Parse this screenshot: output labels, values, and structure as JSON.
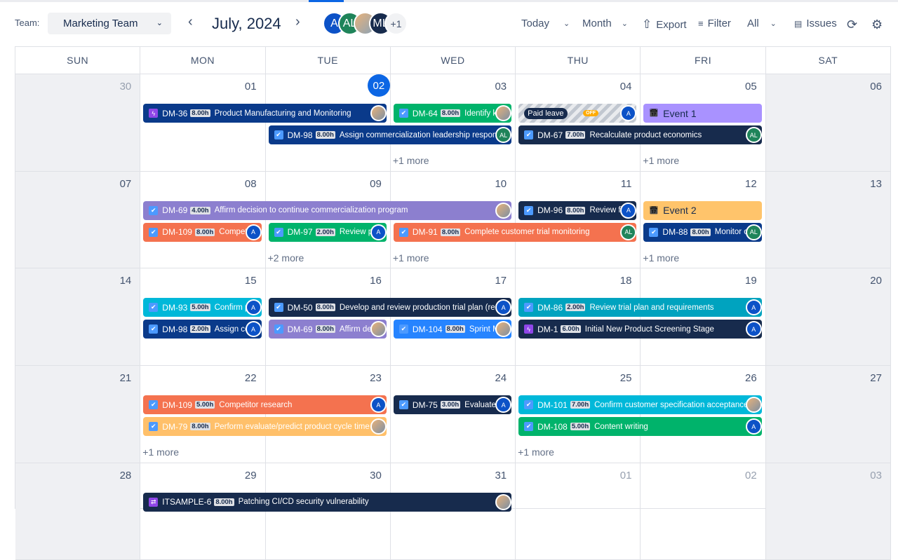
{
  "header": {
    "team_label": "Team:",
    "team_value": "Marketing Team",
    "month_title": "July, 2024",
    "avatars": [
      {
        "initials": "A",
        "color": "#0c52c7"
      },
      {
        "initials": "AL",
        "color": "#1f845a"
      },
      {
        "initials": "",
        "color": "#c9a27e"
      },
      {
        "initials": "ML",
        "color": "#172b4d"
      }
    ],
    "more_avatars": "+1",
    "today_label": "Today",
    "view_label": "Month",
    "export_label": "Export",
    "filter_label": "Filter",
    "filter_value": "All",
    "issues_label": "Issues"
  },
  "calendar": {
    "day_headers": [
      "SUN",
      "MON",
      "TUE",
      "WED",
      "THU",
      "FRI",
      "SAT"
    ],
    "today_date": "02",
    "weeks": [
      {
        "dates": [
          "30",
          "01",
          "02",
          "03",
          "04",
          "05",
          "06"
        ],
        "outside": [
          0
        ],
        "lanes": [
          [
            {
              "start": 1,
              "days": 2,
              "key": "DM-36",
              "hours": "8.00h",
              "title": "Product Manufacturing and Monitoring",
              "color": "#0a3a8a",
              "icon": "bolt",
              "assignee": "photo"
            },
            {
              "start": 3,
              "days": 1,
              "key": "DM-64",
              "hours": "8.00h",
              "title": "Identify key",
              "color": "#00b36b",
              "icon": "check",
              "assignee": "photo"
            },
            {
              "start": 4,
              "days": 1,
              "type": "leave",
              "title": "Paid leave",
              "badge": "OFF",
              "assignee": "A"
            },
            {
              "start": 5,
              "days": 1,
              "type": "event",
              "title": "Event 1",
              "color": "#a992ff"
            }
          ],
          [
            {
              "start": 2,
              "days": 2,
              "key": "DM-98",
              "hours": "8.00h",
              "title": "Assign commercialization leadership respon",
              "color": "#0a3a8a",
              "icon": "check",
              "assignee": "AL"
            },
            {
              "start": 4,
              "days": 2,
              "key": "DM-67",
              "hours": "7.00h",
              "title": "Recalculate product economics",
              "color": "#172b4d",
              "icon": "check",
              "assignee": "AL"
            }
          ]
        ],
        "more": [
          {
            "day": 3,
            "label": "+1 more"
          },
          {
            "day": 5,
            "label": "+1 more"
          }
        ]
      },
      {
        "dates": [
          "07",
          "08",
          "09",
          "10",
          "11",
          "12",
          "13"
        ],
        "outside": [],
        "lanes": [
          [
            {
              "start": 1,
              "days": 3,
              "key": "DM-69",
              "hours": "4.00h",
              "title": "Affirm decision to continue commercialization program",
              "color": "#8c7fcf",
              "icon": "check",
              "assignee": "photo"
            },
            {
              "start": 4,
              "days": 1,
              "key": "DM-96",
              "hours": "8.00h",
              "title": "Review fi",
              "color": "#172b4d",
              "icon": "check",
              "assignee": "A"
            },
            {
              "start": 5,
              "days": 1,
              "type": "event",
              "title": "Event 2",
              "color": "#ffc46b"
            }
          ],
          [
            {
              "start": 1,
              "days": 1,
              "key": "DM-109",
              "hours": "8.00h",
              "title": "Compet",
              "color": "#f4724f",
              "icon": "check",
              "assignee": "A"
            },
            {
              "start": 2,
              "days": 1,
              "key": "DM-97",
              "hours": "2.00h",
              "title": "Review pa",
              "color": "#00b36b",
              "icon": "check",
              "assignee": "A"
            },
            {
              "start": 3,
              "days": 2,
              "key": "DM-91",
              "hours": "8.00h",
              "title": "Complete customer trial monitoring",
              "color": "#f4724f",
              "icon": "check",
              "assignee": "AL"
            },
            {
              "start": 5,
              "days": 1,
              "key": "DM-88",
              "hours": "8.00h",
              "title": "Monitor c",
              "color": "#0a3a8a",
              "icon": "check",
              "assignee": "AL"
            }
          ]
        ],
        "more": [
          {
            "day": 2,
            "label": "+2 more"
          },
          {
            "day": 3,
            "label": "+1 more"
          },
          {
            "day": 5,
            "label": "+1 more"
          }
        ]
      },
      {
        "dates": [
          "14",
          "15",
          "16",
          "17",
          "18",
          "19",
          "20"
        ],
        "outside": [],
        "lanes": [
          [
            {
              "start": 1,
              "days": 1,
              "key": "DM-93",
              "hours": "5.00h",
              "title": "Confirm p",
              "color": "#00b8d9",
              "icon": "check",
              "assignee": "A"
            },
            {
              "start": 2,
              "days": 2,
              "key": "DM-50",
              "hours": "8.00h",
              "title": "Develop and review production trial plan (re",
              "color": "#172b4d",
              "icon": "check",
              "assignee": "A"
            },
            {
              "start": 4,
              "days": 2,
              "key": "DM-86",
              "hours": "2.00h",
              "title": "Review trial plan and requirements",
              "color": "#00a3bf",
              "icon": "check",
              "assignee": "A"
            }
          ],
          [
            {
              "start": 1,
              "days": 1,
              "key": "DM-98",
              "hours": "2.00h",
              "title": "Assign co",
              "color": "#0a3a8a",
              "icon": "check",
              "assignee": "A"
            },
            {
              "start": 2,
              "days": 1,
              "key": "DM-69",
              "hours": "8.00h",
              "title": "Affirm de",
              "color": "#8c7fcf",
              "icon": "check",
              "assignee": "photo"
            },
            {
              "start": 3,
              "days": 1,
              "key": "DM-104",
              "hours": "8.00h",
              "title": "Sprint M",
              "color": "#2684ff",
              "icon": "check",
              "assignee": "photo"
            },
            {
              "start": 4,
              "days": 2,
              "key": "DM-1",
              "hours": "6.00h",
              "title": "Initial New Product Screening Stage",
              "color": "#172b4d",
              "icon": "bolt",
              "assignee": "A"
            }
          ]
        ],
        "more": []
      },
      {
        "dates": [
          "21",
          "22",
          "23",
          "24",
          "25",
          "26",
          "27"
        ],
        "outside": [],
        "lanes": [
          [
            {
              "start": 1,
              "days": 2,
              "key": "DM-109",
              "hours": "5.00h",
              "title": "Competitor research",
              "color": "#f4724f",
              "icon": "check",
              "assignee": "A"
            },
            {
              "start": 3,
              "days": 1,
              "key": "DM-75",
              "hours": "3.00h",
              "title": "Evaluate",
              "color": "#172b4d",
              "icon": "check",
              "assignee": "A"
            },
            {
              "start": 4,
              "days": 2,
              "key": "DM-101",
              "hours": "7.00h",
              "title": "Confirm customer specification acceptance",
              "color": "#00b8d9",
              "icon": "check",
              "assignee": "photo"
            }
          ],
          [
            {
              "start": 1,
              "days": 2,
              "key": "DM-79",
              "hours": "8.00h",
              "title": "Perform evaluate/predict product cycle time",
              "color": "#ffc06a",
              "icon": "check",
              "assignee": "photo"
            },
            {
              "start": 4,
              "days": 2,
              "key": "DM-108",
              "hours": "5.00h",
              "title": "Content writing",
              "color": "#00b36b",
              "icon": "check",
              "assignee": "A"
            }
          ]
        ],
        "more": [
          {
            "day": 1,
            "label": "+1 more"
          },
          {
            "day": 4,
            "label": "+1 more"
          }
        ]
      },
      {
        "dates": [
          "28",
          "29",
          "30",
          "31",
          "01",
          "02",
          "03"
        ],
        "outside": [
          4,
          5,
          6
        ],
        "lanes": [
          [
            {
              "start": 1,
              "days": 3,
              "key": "ITSAMPLE-6",
              "hours": "8.00h",
              "title": "Patching CI/CD security vulnerability",
              "color": "#172b4d",
              "icon": "subtask",
              "assignee": "photo"
            }
          ]
        ],
        "more": []
      }
    ]
  },
  "colors": {
    "today": "#0c66e4",
    "weekend": "#eff0f3",
    "assignee_A": "#0c52c7",
    "assignee_AL": "#1f845a"
  }
}
